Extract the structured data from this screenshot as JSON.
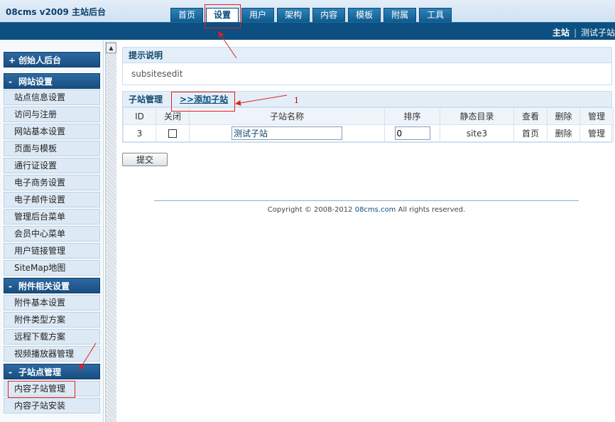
{
  "header": {
    "brand": "08cms  v2009  主站后台",
    "nav_tabs": [
      "首页",
      "设置",
      "用户",
      "架构",
      "内容",
      "模板",
      "附属",
      "工具"
    ],
    "active_tab": "设置",
    "sub_main": "主站",
    "sub_sep": "|",
    "sub_site": "测试子站"
  },
  "sidebar": {
    "groups": [
      {
        "label": "创始人后台",
        "toggle": "+",
        "items": []
      },
      {
        "label": "网站设置",
        "toggle": "-",
        "items": [
          "站点信息设置",
          "访问与注册",
          "网站基本设置",
          "页面与模板",
          "通行证设置",
          "电子商务设置",
          "电子邮件设置",
          "管理后台菜单",
          "会员中心菜单",
          "用户链接管理",
          "SiteMap地图"
        ]
      },
      {
        "label": "附件相关设置",
        "toggle": "-",
        "items": [
          "附件基本设置",
          "附件类型方案",
          "远程下载方案",
          "视频播放器管理"
        ]
      },
      {
        "label": "子站点管理",
        "toggle": "-",
        "items": [
          "内容子站管理",
          "内容子站安装"
        ]
      }
    ]
  },
  "info": {
    "title": "提示说明",
    "body": "subsitesedit"
  },
  "subsites": {
    "title": "子站管理",
    "add_link": ">>添加子站",
    "columns": [
      "ID",
      "关闭",
      "子站名称",
      "排序",
      "静态目录",
      "查看",
      "删除",
      "管理"
    ],
    "rows": [
      {
        "id": "3",
        "closed": false,
        "name": "测试子站",
        "order": "0",
        "dir": "site3",
        "view": "首页",
        "delete": "删除",
        "manage": "管理"
      }
    ]
  },
  "submit_label": "提交",
  "footer": {
    "prefix": "Copyright © 2008-2012 ",
    "site": "08cms.com",
    "suffix": " All rights reserved."
  },
  "annotation_number": "1",
  "colors": {
    "nav_blue": "#0d4f80",
    "group_blue": "#184e80",
    "annotation_red": "#e02020"
  }
}
